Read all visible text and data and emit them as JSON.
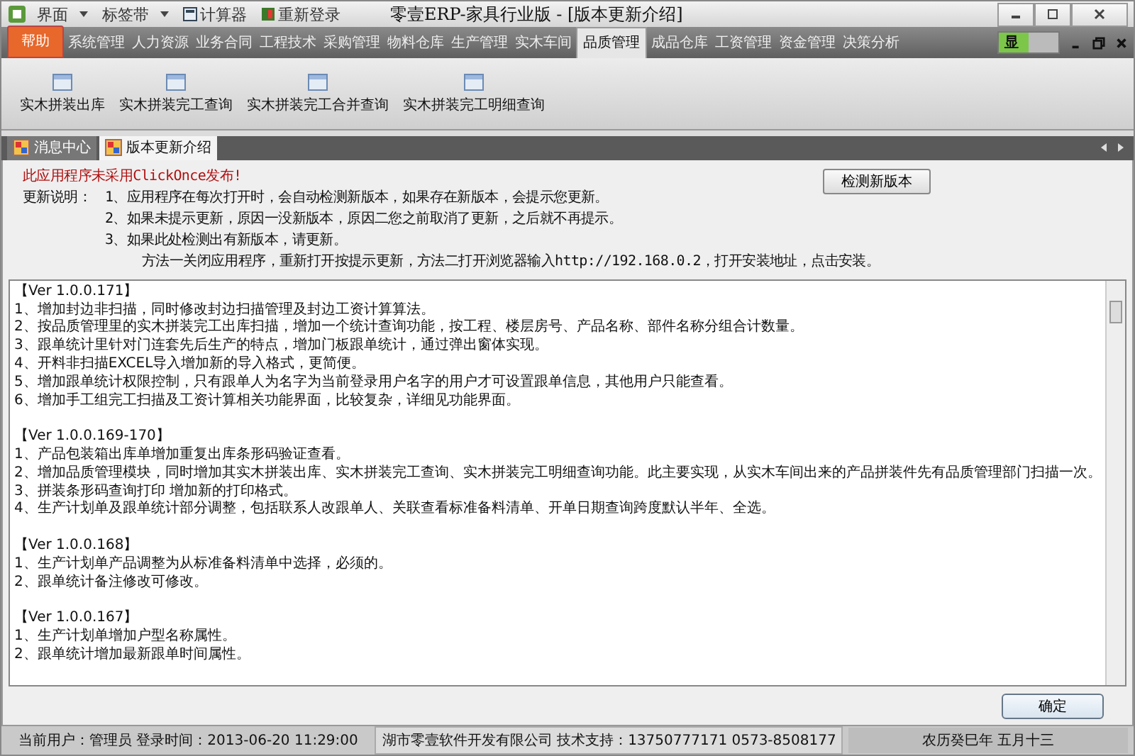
{
  "window": {
    "title": "零壹ERP-家具行业版 - [版本更新介绍]"
  },
  "quick_access": [
    {
      "label": "界面",
      "dropdown": true
    },
    {
      "label": "标签带",
      "dropdown": true
    },
    {
      "label": "计算器",
      "dropdown": false
    },
    {
      "label": "重新登录",
      "dropdown": false
    }
  ],
  "menu_tabs": [
    {
      "label": "帮助",
      "kind": "help",
      "selected": false
    },
    {
      "label": "系统管理",
      "kind": "tab",
      "selected": false
    },
    {
      "label": "人力资源",
      "kind": "tab",
      "selected": false
    },
    {
      "label": "业务合同",
      "kind": "tab",
      "selected": false
    },
    {
      "label": "工程技术",
      "kind": "tab",
      "selected": false
    },
    {
      "label": "采购管理",
      "kind": "tab",
      "selected": false
    },
    {
      "label": "物料仓库",
      "kind": "tab",
      "selected": false
    },
    {
      "label": "生产管理",
      "kind": "tab",
      "selected": false
    },
    {
      "label": "实木车间",
      "kind": "tab",
      "selected": false
    },
    {
      "label": "品质管理",
      "kind": "tab",
      "selected": true
    },
    {
      "label": "成品仓库",
      "kind": "tab",
      "selected": false
    },
    {
      "label": "工资管理",
      "kind": "tab",
      "selected": false
    },
    {
      "label": "资金管理",
      "kind": "tab",
      "selected": false
    },
    {
      "label": "决策分析",
      "kind": "tab",
      "selected": false
    }
  ],
  "show_button": "显",
  "ribbon_buttons": [
    "实木拼装出库",
    "实木拼装完工查询",
    "实木拼装完工合并查询",
    "实木拼装完工明细查询"
  ],
  "doc_tabs": [
    {
      "label": "消息中心",
      "selected": false
    },
    {
      "label": "版本更新介绍",
      "selected": true
    }
  ],
  "notice": {
    "warning": "此应用程序未采用ClickOnce发布!",
    "check_button": "检测新版本",
    "label": "更新说明：",
    "lines": [
      "1、应用程序在每次打开时，会自动检测新版本，如果存在新版本，会提示您更新。",
      "2、如果未提示更新，原因一没新版本，原因二您之前取消了更新，之后就不再提示。",
      "3、如果此处检测出有新版本，请更新。",
      "方法一关闭应用程序，重新打开按提示更新，方法二打开浏览器输入http://192.168.0.2，打开安装地址，点击安装。"
    ]
  },
  "changelog": [
    {
      "version": "【Ver 1.0.0.171】",
      "items": [
        "1、增加封边非扫描，同时修改封边扫描管理及封边工资计算算法。",
        "2、按品质管理里的实木拼装完工出库扫描，增加一个统计查询功能，按工程、楼层房号、产品名称、部件名称分组合计数量。",
        "3、跟单统计里针对门连套先后生产的特点，增加门板跟单统计，通过弹出窗体实现。",
        "4、开料非扫描EXCEL导入增加新的导入格式，更简便。",
        "5、增加跟单统计权限控制，只有跟单人为名字为当前登录用户名字的用户才可设置跟单信息，其他用户只能查看。",
        "6、增加手工组完工扫描及工资计算相关功能界面，比较复杂，详细见功能界面。"
      ]
    },
    {
      "version": "【Ver 1.0.0.169-170】",
      "items": [
        "1、产品包装箱出库单增加重复出库条形码验证查看。",
        "2、增加品质管理模块，同时增加其实木拼装出库、实木拼装完工查询、实木拼装完工明细查询功能。此主要实现，从实木车间出来的产品拼装件先有品质管理部门扫描一次。",
        "3、拼装条形码查询打印 增加新的打印格式。",
        "4、生产计划单及跟单统计部分调整，包括联系人改跟单人、关联查看标准备料清单、开单日期查询跨度默认半年、全选。"
      ]
    },
    {
      "version": "【Ver 1.0.0.168】",
      "items": [
        "1、生产计划单产品调整为从标准备料清单中选择，必须的。",
        "2、跟单统计备注修改可修改。"
      ]
    },
    {
      "version": "【Ver 1.0.0.167】",
      "items": [
        "1、生产计划单增加户型名称属性。",
        "2、跟单统计增加最新跟单时间属性。"
      ]
    }
  ],
  "ok_button": "确定",
  "status_bar": {
    "user": "当前用户：管理员 登录时间：2013-06-20 11:29:00",
    "company": "湖市零壹软件开发有限公司 技术支持：13750777171 0573-8508177",
    "lunar": "农历癸巳年 五月十三"
  }
}
